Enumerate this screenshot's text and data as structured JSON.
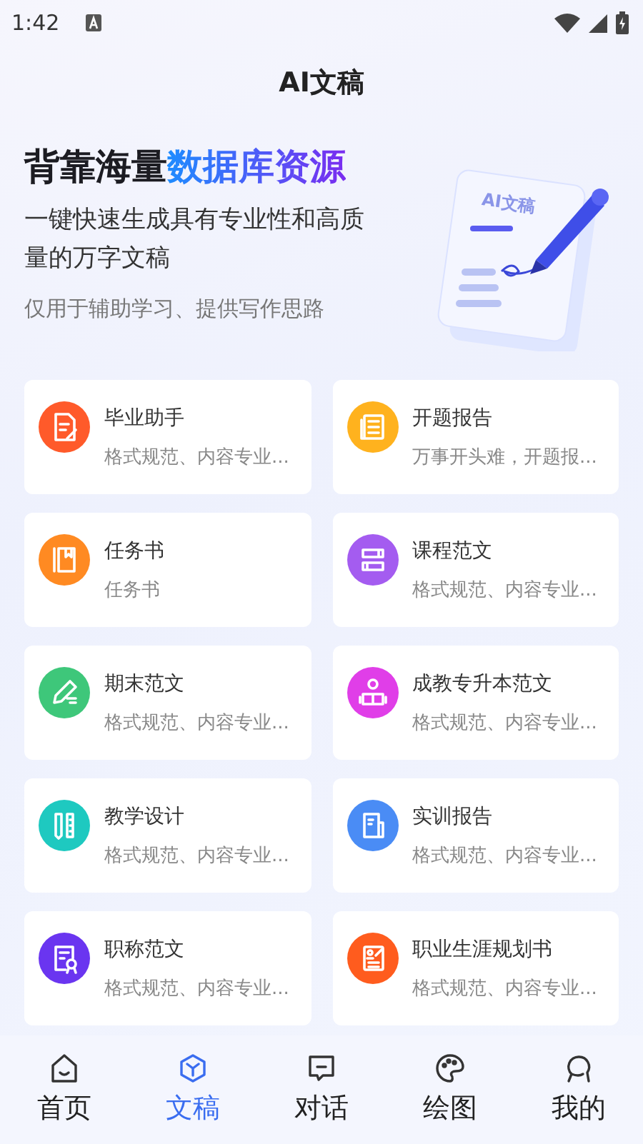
{
  "status_bar": {
    "time": "1:42"
  },
  "header": {
    "title": "AI文稿"
  },
  "hero": {
    "title_plain": "背靠海量",
    "title_highlight": "数据库资源",
    "subtitle": "一键快速生成具有专业性和高质量的万字文稿",
    "note": "仅用于辅助学习、提供写作思路",
    "illustration_label": "AI文稿"
  },
  "cards": [
    {
      "title": "毕业助手",
      "desc": "格式规范、内容专业...",
      "color": "#ff5a2a"
    },
    {
      "title": "开题报告",
      "desc": "万事开头难，开题报...",
      "color": "#ffb21e"
    },
    {
      "title": "任务书",
      "desc": "任务书",
      "color": "#ff8a22"
    },
    {
      "title": "课程范文",
      "desc": "格式规范、内容专业...",
      "color": "#a45cf0"
    },
    {
      "title": "期末范文",
      "desc": "格式规范、内容专业...",
      "color": "#3ec77a"
    },
    {
      "title": "成教专升本范文",
      "desc": "格式规范、内容专业...",
      "color": "#e03ee8"
    },
    {
      "title": "教学设计",
      "desc": "格式规范、内容专业...",
      "color": "#1ec9c0"
    },
    {
      "title": "实训报告",
      "desc": "格式规范、内容专业...",
      "color": "#4a8cf5"
    },
    {
      "title": "职称范文",
      "desc": "格式规范、内容专业...",
      "color": "#6a35f0"
    },
    {
      "title": "职业生涯规划书",
      "desc": "格式规范、内容专业...",
      "color": "#ff5c1e"
    }
  ],
  "tabs": [
    {
      "label": "首页",
      "selected": false
    },
    {
      "label": "文稿",
      "selected": true
    },
    {
      "label": "对话",
      "selected": false
    },
    {
      "label": "绘图",
      "selected": false
    },
    {
      "label": "我的",
      "selected": false
    }
  ]
}
